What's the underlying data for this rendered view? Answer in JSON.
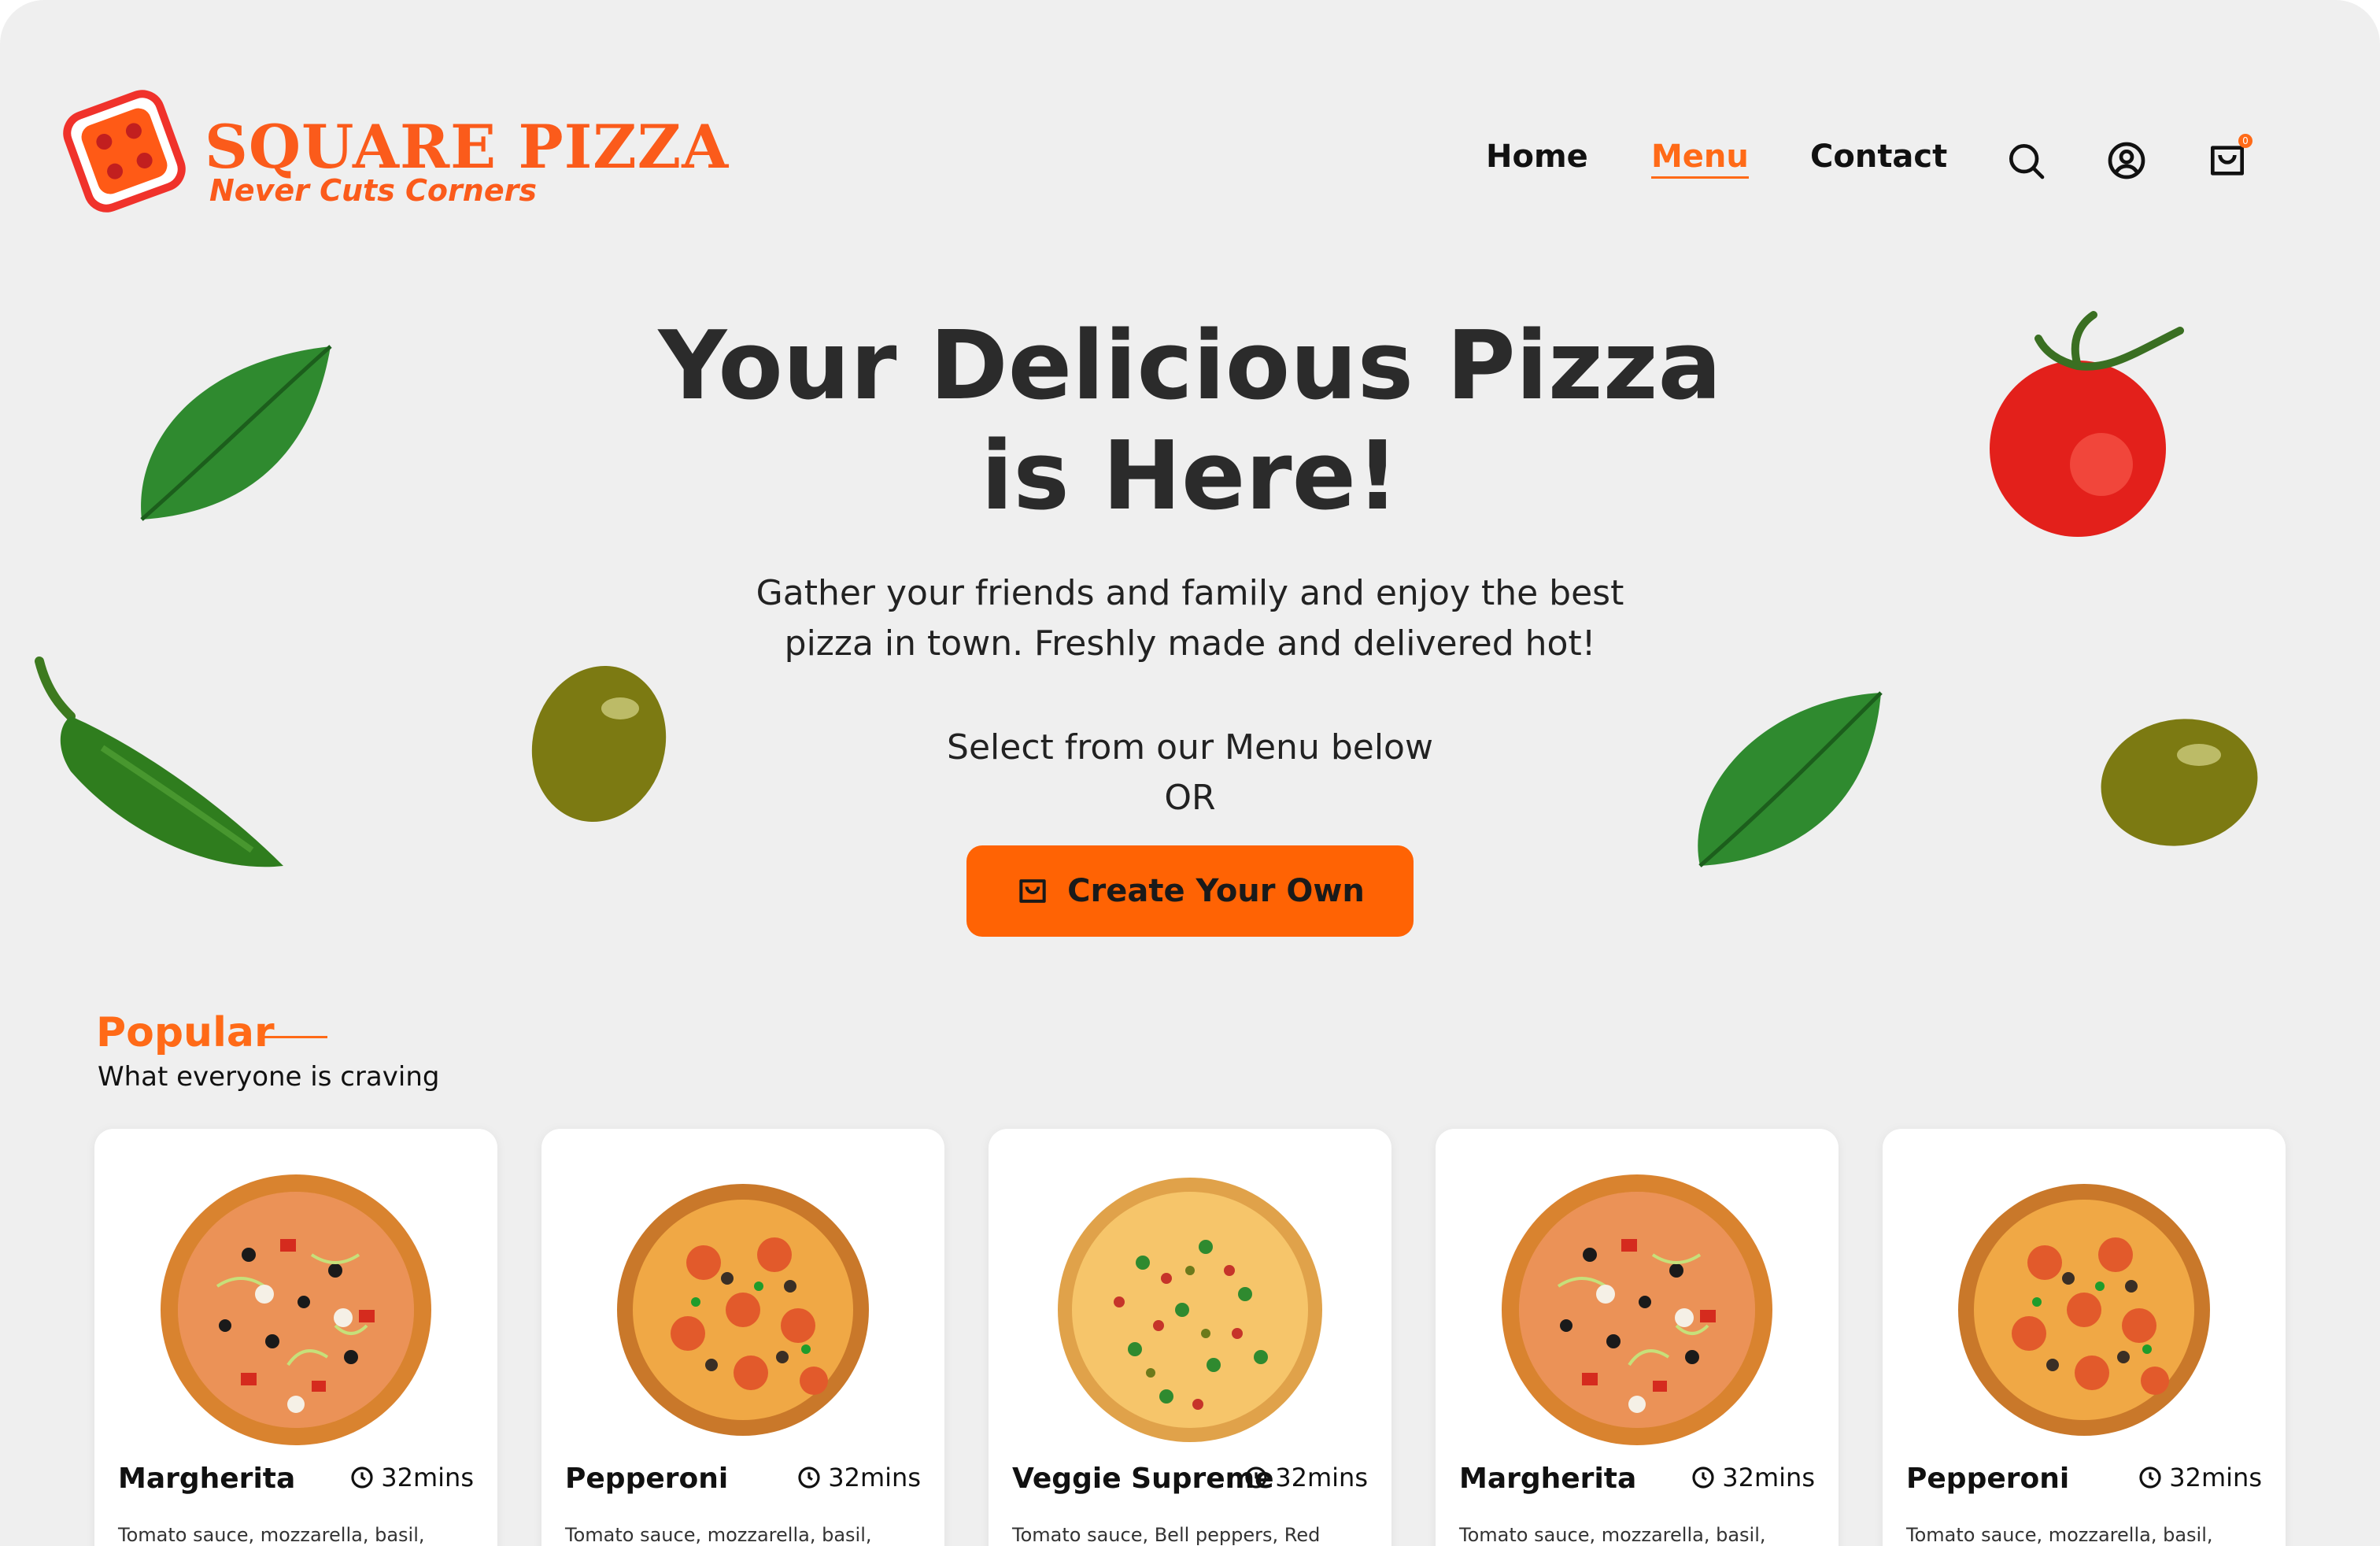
{
  "brand": {
    "title": "SQUARE PIZZA",
    "tagline": "Never Cuts Corners",
    "color": "#fb5b1b"
  },
  "nav": {
    "items": [
      {
        "label": "Home",
        "active": false
      },
      {
        "label": "Menu",
        "active": true
      },
      {
        "label": "Contact",
        "active": false
      }
    ],
    "icons": [
      "search-icon",
      "user-icon",
      "cart-icon"
    ],
    "cart_count": "0"
  },
  "hero": {
    "title_line1": "Your Delicious Pizza",
    "title_line2": "is Here!",
    "desc_line1": "Gather your friends and family and enjoy the best",
    "desc_line2": "pizza in town. Freshly made and delivered hot!",
    "select_line1": "Select from our Menu below",
    "select_line2": "OR",
    "cta_label": "Create Your Own",
    "cta_color": "#ff6304"
  },
  "popular": {
    "title": "Popular",
    "subtitle": "What everyone is craving",
    "items": [
      {
        "name": "Margherita",
        "time": "32mins",
        "desc": "Tomato sauce, mozzarella, basil,",
        "variant": "mix"
      },
      {
        "name": "Pepperoni",
        "time": "32mins",
        "desc": "Tomato sauce, mozzarella, basil,",
        "variant": "pepperoni"
      },
      {
        "name": "Veggie Supreme",
        "time": "32mins",
        "desc": "Tomato sauce, Bell peppers, Red",
        "variant": "veggie"
      },
      {
        "name": "Margherita",
        "time": "32mins",
        "desc": "Tomato sauce, mozzarella, basil,",
        "variant": "mix"
      },
      {
        "name": "Pepperoni",
        "time": "32mins",
        "desc": "Tomato sauce, mozzarella, basil,",
        "variant": "pepperoni"
      }
    ]
  },
  "accent_color": "#ff6a17"
}
